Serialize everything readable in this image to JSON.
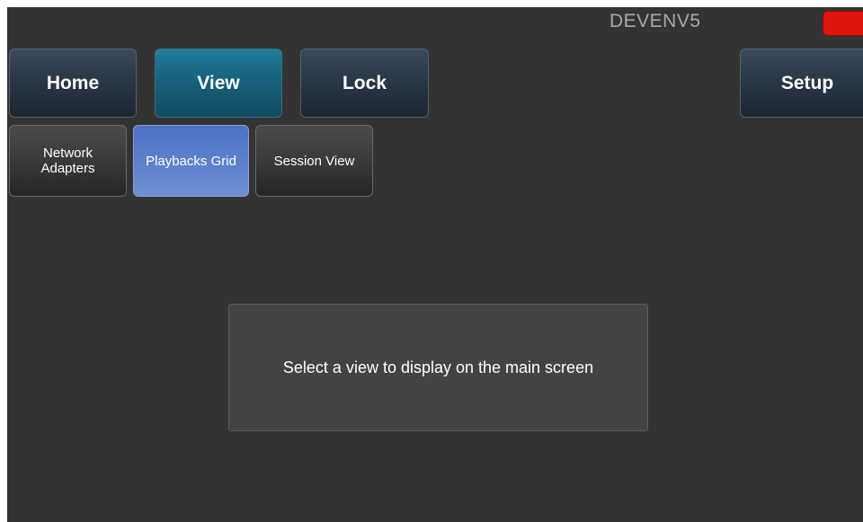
{
  "header": {
    "device_name": "DEVENV5"
  },
  "status": {
    "indicator_color": "#e0150c",
    "indicator_icon": "status-indicator-icon"
  },
  "main_nav": {
    "home_label": "Home",
    "view_label": "View",
    "lock_label": "Lock",
    "setup_label": "Setup",
    "active": "View"
  },
  "sub_nav": {
    "network_adapters_label": "Network\nAdapters",
    "playbacks_grid_label": "Playbacks Grid",
    "session_view_label": "Session View",
    "active": "Playbacks Grid"
  },
  "main": {
    "message": "Select a view to display on the main screen"
  },
  "colors": {
    "background": "#333333",
    "active_main_button": "#17627c",
    "active_sub_button": "#5b80cc",
    "status_red": "#e0150c"
  }
}
